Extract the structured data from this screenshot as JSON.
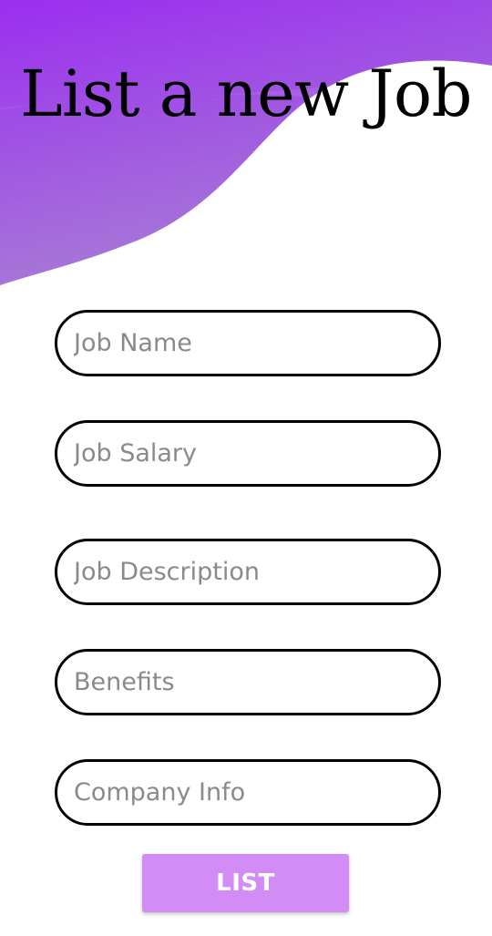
{
  "header": {
    "title": "List a new Job",
    "gradient_start": "#9b2ef0",
    "gradient_end": "#a77ed4"
  },
  "form": {
    "fields": [
      {
        "name": "job-name",
        "placeholder": "Job Name",
        "value": ""
      },
      {
        "name": "job-salary",
        "placeholder": "Job Salary",
        "value": ""
      },
      {
        "name": "job-description",
        "placeholder": "Job Description",
        "value": ""
      },
      {
        "name": "benefits",
        "placeholder": "Benefits",
        "value": ""
      },
      {
        "name": "company-info",
        "placeholder": "Company Info",
        "value": ""
      }
    ],
    "submit_label": "LIST",
    "submit_color": "#d38cf5"
  }
}
